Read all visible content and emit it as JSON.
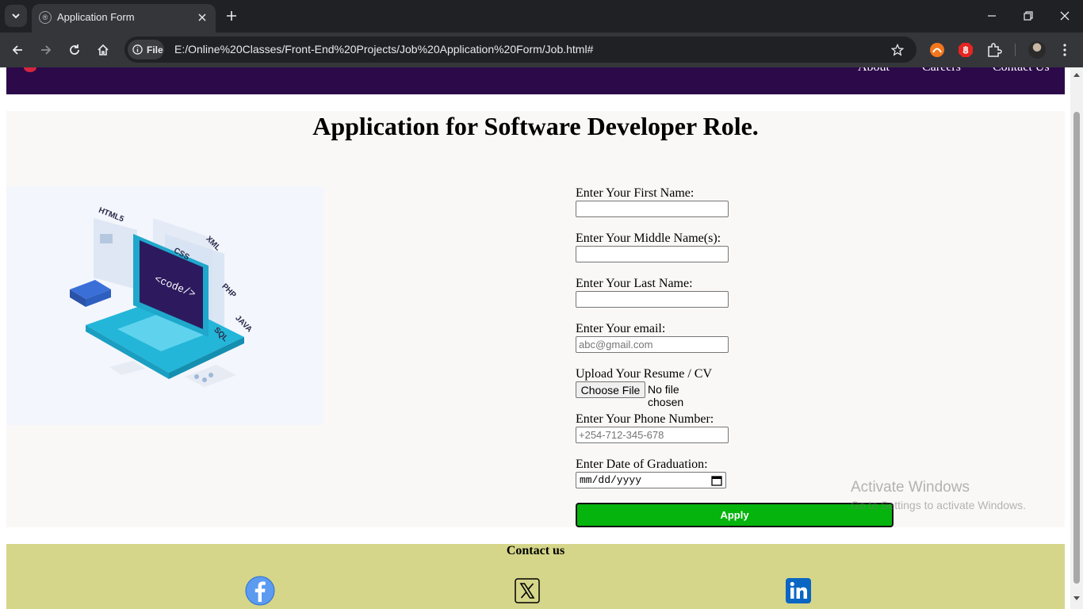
{
  "browser": {
    "tab_title": "Application Form",
    "security_chip_label": "File",
    "url": "E:/Online%20Classes/Front-End%20Projects/Job%20Application%20Form/Job.html#"
  },
  "site_nav": {
    "items": [
      {
        "label": "About"
      },
      {
        "label": "Careers"
      },
      {
        "label": "Contact Us"
      }
    ]
  },
  "main": {
    "title": "Application for Software Developer Role.",
    "image_labels": {
      "code": "<code/>",
      "tags": [
        "HTML5",
        "CSS",
        "XML",
        "PHP",
        "JAVA",
        "SQL"
      ]
    }
  },
  "form": {
    "first_name_label": "Enter Your First Name:",
    "middle_name_label": "Enter Your Middle Name(s):",
    "last_name_label": "Enter Your Last Name:",
    "email_label": "Enter Your email:",
    "email_placeholder": "abc@gmail.com",
    "resume_label": "Upload Your Resume / CV",
    "file_button": "Choose File",
    "file_status": "No file chosen",
    "phone_label": "Enter Your Phone Number:",
    "phone_placeholder": "+254-712-345-678",
    "graduation_label": "Enter Date of Graduation:",
    "date_placeholder": "mm/dd/yyyy",
    "apply_button": "Apply"
  },
  "footer": {
    "title": "Contact us",
    "social": [
      "facebook-icon",
      "x-icon",
      "linkedin-icon"
    ]
  },
  "watermark": {
    "title": "Activate Windows",
    "subtitle": "Go to Settings to activate Windows."
  },
  "colors": {
    "header_bg": "#2c0a4a",
    "apply_button": "#05b40d",
    "footer_bg": "#d5d68a",
    "page_bg": "#faf8f6"
  }
}
